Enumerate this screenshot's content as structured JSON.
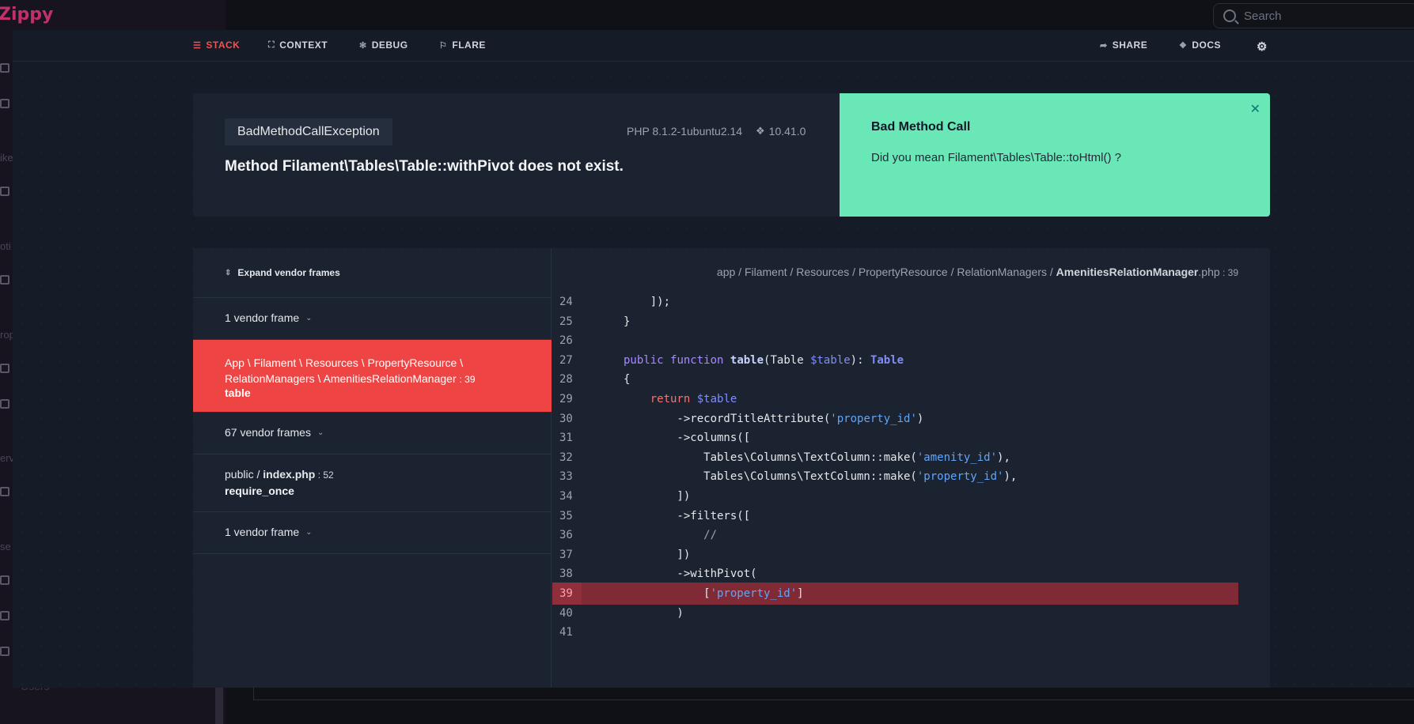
{
  "background_app": {
    "brand": "Zippy",
    "search_placeholder": "Search",
    "sidebar_fragments": [
      "ike",
      "oti",
      "rop",
      "erv",
      "se"
    ],
    "sidebar_users": "Users"
  },
  "nav": {
    "stack": "STACK",
    "context": "CONTEXT",
    "debug": "DEBUG",
    "flare": "FLARE",
    "share": "SHARE",
    "docs": "DOCS"
  },
  "error": {
    "exception_class": "BadMethodCallException",
    "php_version": "PHP 8.1.2-1ubuntu2.14",
    "laravel_version": "10.41.0",
    "message": "Method Filament\\Tables\\Table::withPivot does not exist."
  },
  "solution": {
    "title": "Bad Method Call",
    "text": "Did you mean Filament\\Tables\\Table::toHtml() ?"
  },
  "frames": {
    "expand_label": "Expand vendor frames",
    "vendor_1": "1 vendor frame",
    "active_path": "App \\ Filament \\ Resources \\ PropertyResource \\ RelationManagers \\ AmenitiesRelationManager",
    "active_line": ": 39",
    "active_fn": "table",
    "vendor_67": "67 vendor frames",
    "public_dir": "public / ",
    "public_file": "index.php",
    "public_line": " : 52",
    "public_fn": "require_once",
    "vendor_last": "1 vendor frame"
  },
  "file": {
    "dir": "app / Filament / Resources / PropertyResource / RelationManagers / ",
    "name": "AmenitiesRelationManager",
    "ext": ".php",
    "line": " : 39"
  },
  "code": {
    "highlight_line": 39,
    "lines": [
      {
        "n": "24",
        "text": "        ]);"
      },
      {
        "n": "25",
        "text": "    }"
      },
      {
        "n": "26",
        "text": ""
      },
      {
        "n": "27",
        "text": "    public function table(Table $table): Table"
      },
      {
        "n": "28",
        "text": "    {"
      },
      {
        "n": "29",
        "text": "        return $table"
      },
      {
        "n": "30",
        "text": "            ->recordTitleAttribute('property_id')"
      },
      {
        "n": "31",
        "text": "            ->columns(["
      },
      {
        "n": "32",
        "text": "                Tables\\Columns\\TextColumn::make('amenity_id'),"
      },
      {
        "n": "33",
        "text": "                Tables\\Columns\\TextColumn::make('property_id'),"
      },
      {
        "n": "34",
        "text": "            ])"
      },
      {
        "n": "35",
        "text": "            ->filters(["
      },
      {
        "n": "36",
        "text": "                //"
      },
      {
        "n": "37",
        "text": "            ])"
      },
      {
        "n": "38",
        "text": "            ->withPivot("
      },
      {
        "n": "39",
        "text": "                ['property_id']"
      },
      {
        "n": "40",
        "text": "            )"
      },
      {
        "n": "41",
        "text": ""
      }
    ]
  },
  "colors": {
    "accent_red": "#ef4444",
    "solution_green": "#6ae7b6",
    "highlight_row": "#7f2a35"
  }
}
